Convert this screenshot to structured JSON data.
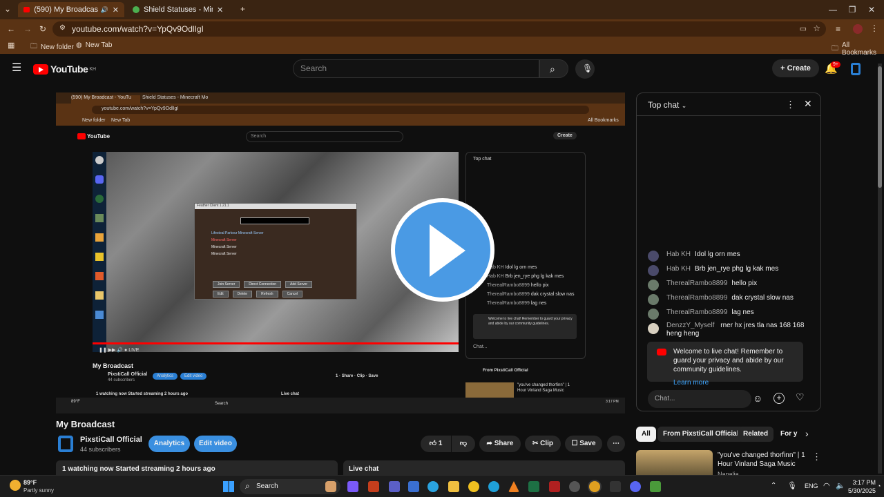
{
  "browser": {
    "tabs": [
      {
        "title": "(590) My Broadcast - YouTu",
        "active": true
      },
      {
        "title": "Shield Statuses - Minecraft Mo",
        "active": false
      }
    ],
    "url": "youtube.com/watch?v=YpQv9OdlIgI",
    "bookmarks": [
      "New folder",
      "New Tab"
    ],
    "all_bookmarks": "All Bookmarks"
  },
  "youtube": {
    "logo_text": "YouTube",
    "region": "KH",
    "search_placeholder": "Search",
    "create_label": "Create",
    "notif_count": "9+"
  },
  "video": {
    "title": "My Broadcast",
    "channel": "PixstiCall Official",
    "subscribers": "44 subscribers",
    "analytics_label": "Analytics",
    "edit_label": "Edit video",
    "likes": "1",
    "share_label": "Share",
    "clip_label": "Clip",
    "save_label": "Save",
    "watching": "1 watching now  Started streaming 2 hours ago",
    "live_chat": "Live chat"
  },
  "chat": {
    "header": "Top chat",
    "messages": [
      {
        "author": "Hab KH",
        "text": "Idol lg orn mes"
      },
      {
        "author": "Hab KH",
        "text": "Brb jen_rye phg lg kak mes"
      },
      {
        "author": "TherealRambo8899",
        "text": "hello pix"
      },
      {
        "author": "TherealRambo8899",
        "text": "dak crystal slow nas"
      },
      {
        "author": "TherealRambo8899",
        "text": "lag nes"
      },
      {
        "author": "DenzzY_Myself",
        "text": "rner hx jres tla nas 168 168 heng heng"
      }
    ],
    "welcome": "Welcome to live chat! Remember to guard your privacy and abide by our community guidelines.",
    "learn_more": "Learn more",
    "input_placeholder": "Chat..."
  },
  "filters": [
    "All",
    "From PixstiCall Official",
    "Related",
    "For y"
  ],
  "recommended": {
    "title": "\"you've changed thorfinn\" | 1 Hour Vinland Saga Music",
    "channel": "Nanalia"
  },
  "taskbar": {
    "weather_temp": "89°F",
    "weather_desc": "Partly sunny",
    "search_label": "Search",
    "lang": "ENG",
    "time": "3:17 PM",
    "date": "5/30/2025"
  },
  "inner": {
    "url": "youtube.com/watch?v=YpQv9OdlIgI",
    "mc_window_title": "Feather Client 1.21.1",
    "servers": [
      "Lifesteal Parkour Minecraft Server",
      "Minecraft Server",
      "Minecraft Server",
      "Minecraft Server"
    ],
    "buttons": [
      "Join Server",
      "Direct Connection",
      "Add Server",
      "Edit",
      "Delete",
      "Refresh",
      "Cancel"
    ]
  }
}
